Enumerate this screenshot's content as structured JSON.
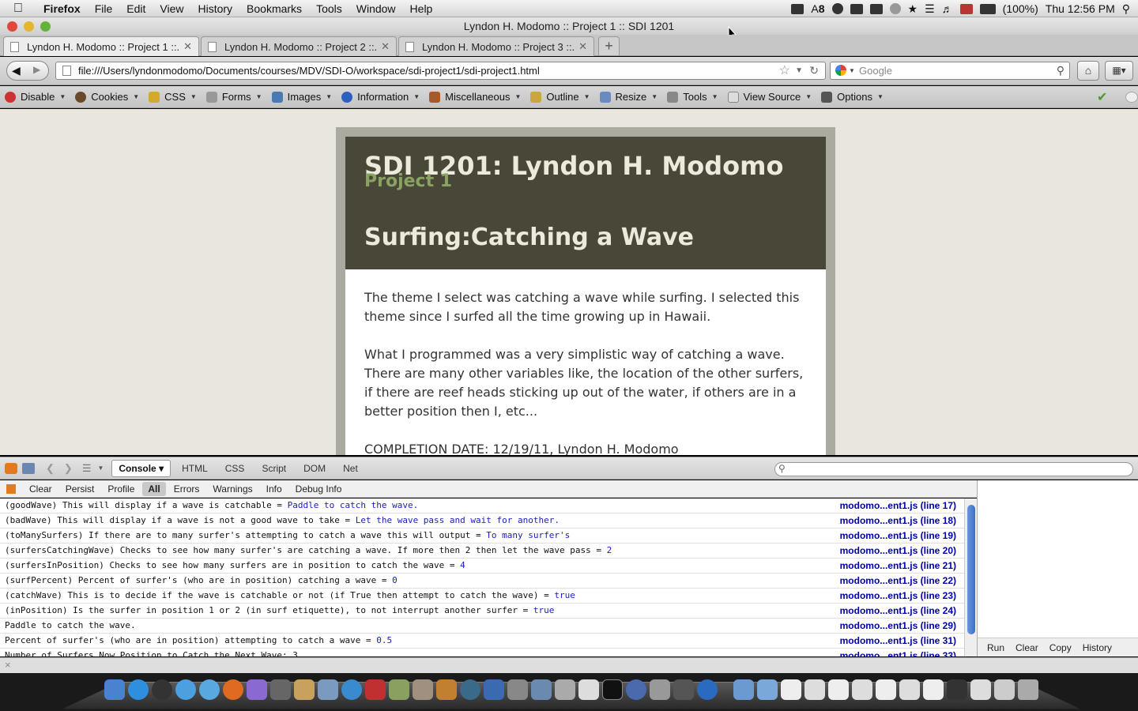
{
  "menubar": {
    "apple": "",
    "items": [
      "Firefox",
      "File",
      "Edit",
      "View",
      "History",
      "Bookmarks",
      "Tools",
      "Window",
      "Help"
    ],
    "status": {
      "badge": "8",
      "battery": "(100%)",
      "clock": "Thu 12:56 PM"
    }
  },
  "window": {
    "title": "Lyndon H. Modomo :: Project 1 :: SDI 1201"
  },
  "tabs": [
    {
      "label": "Lyndon H. Modomo :: Project 1 ::..."
    },
    {
      "label": "Lyndon H. Modomo :: Project 2 ::..."
    },
    {
      "label": "Lyndon H. Modomo :: Project 3 ::..."
    }
  ],
  "navbar": {
    "url": "file:///Users/lyndonmodomo/Documents/courses/MDV/SDI-O/workspace/sdi-project1/sdi-project1.html",
    "search_placeholder": "Google"
  },
  "devtoolbar": {
    "items": [
      "Disable",
      "Cookies",
      "CSS",
      "Forms",
      "Images",
      "Information",
      "Miscellaneous",
      "Outline",
      "Resize",
      "Tools",
      "View Source",
      "Options"
    ]
  },
  "page": {
    "title": "SDI 1201: Lyndon H. Modomo",
    "subtitle": "Project 1",
    "heading": "Surfing:Catching a Wave",
    "para1": "The theme I select was catching a wave while surfing. I selected this theme since I surfed all the time growing up in Hawaii.",
    "para2": "What I programmed was a very simplistic way of catching a wave. There are many other variables like, the location of the other surfers, if there are reef heads sticking up out of the water, if others are in a better position then I, etc...",
    "completion": "COMPLETION DATE: 12/19/11, Lyndon H. Modomo"
  },
  "firebug": {
    "tabs": [
      "Console",
      "HTML",
      "CSS",
      "Script",
      "DOM",
      "Net"
    ],
    "filters": [
      "Clear",
      "Persist",
      "Profile",
      "All",
      "Errors",
      "Warnings",
      "Info",
      "Debug Info"
    ],
    "cmd_buttons": [
      "Run",
      "Clear",
      "Copy",
      "History"
    ],
    "close": "×",
    "rows": [
      {
        "text": "(goodWave) This will display if a wave is catchable = ",
        "value": "Paddle to catch the wave.",
        "src": "modomo...ent1.js (line 17)"
      },
      {
        "text": "(badWave) This will display if a wave is not a good wave to take = ",
        "value": "Let the wave pass and wait for another.",
        "src": "modomo...ent1.js (line 18)"
      },
      {
        "text": "(toManySurfers) If there are to many surfer's attempting to catch a wave this will output = ",
        "value": "To many surfer's",
        "src": "modomo...ent1.js (line 19)"
      },
      {
        "text": "(surfersCatchingWave) Checks to see how many surfer's are catching a wave.  If more then 2 then let the wave pass = ",
        "value": "2",
        "src": "modomo...ent1.js (line 20)"
      },
      {
        "text": "(surfersInPosition) Checks to see how many surfers are in position to catch the wave = ",
        "value": "4",
        "src": "modomo...ent1.js (line 21)"
      },
      {
        "text": "(surfPercent) Percent of surfer's (who are in position) catching a wave = ",
        "value": "0",
        "src": "modomo...ent1.js (line 22)"
      },
      {
        "text": "(catchWave) This is to decide if the wave is catchable or not (if True then attempt to catch the wave) = ",
        "value": "true",
        "src": "modomo...ent1.js (line 23)"
      },
      {
        "text": "(inPosition) Is the surfer in position 1 or 2 (in surf etiquette), to not interrupt another surfer = ",
        "value": "true",
        "src": "modomo...ent1.js (line 24)"
      },
      {
        "text": "Paddle to catch the wave.",
        "value": "",
        "src": "modomo...ent1.js (line 29)"
      },
      {
        "text": "Percent of surfer's (who are in position) attempting to catch a wave = ",
        "value": "0.5",
        "src": "modomo...ent1.js (line 31)"
      },
      {
        "text": "Number of Surfers Now Position to Catch the Next Wave: 3",
        "value": "",
        "src": "modomo...ent1.js (line 33)"
      }
    ]
  },
  "colors": {
    "header_bg": "#494838",
    "accent_green": "#8aa363",
    "page_bg": "#e8e6dd",
    "link_blue": "#0000a8"
  }
}
